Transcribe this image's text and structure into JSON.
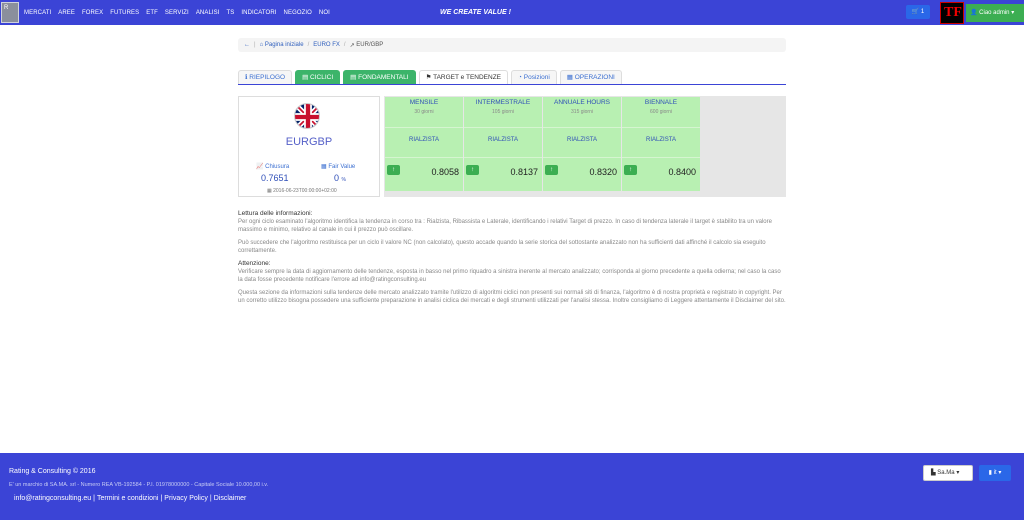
{
  "nav": {
    "items": [
      "MERCATI",
      "AREE",
      "FOREX",
      "FUTURES",
      "ETF",
      "SERVIZI",
      "ANALISI",
      "TS",
      "INDICATORI",
      "NEGOZIO",
      "NOI"
    ],
    "tagline": "WE CREATE VALUE !",
    "cart_count": "1",
    "user_label": "Ciao admin"
  },
  "breadcrumb": {
    "home": "Pagina iniziale",
    "section": "EURO FX",
    "current": "EUR/GBP"
  },
  "tabs": [
    {
      "label": "RIEPILOGO",
      "icon": "info-icon",
      "style": "plain"
    },
    {
      "label": "CICLICI",
      "icon": "chart-icon",
      "style": "green"
    },
    {
      "label": "FONDAMENTALI",
      "icon": "chart-icon",
      "style": "green"
    },
    {
      "label": "TARGET e TENDENZE",
      "icon": "flag-icon",
      "style": "active"
    },
    {
      "label": "Posizioni",
      "icon": "pie-icon",
      "style": "plain"
    },
    {
      "label": "OPERAZIONI",
      "icon": "calendar-icon",
      "style": "plain"
    }
  ],
  "instrument": {
    "name": "EURGBP",
    "close_label": "Chiusura",
    "close_value": "0.7651",
    "fair_label": "Fair Value",
    "fair_value": "0",
    "fair_unit": "%",
    "date": "2016-06-23T00:00:00+02:00"
  },
  "cycles": [
    {
      "name": "MENSILE",
      "period": "30 giorni",
      "trend": "RIALZISTA",
      "target": "0.8058"
    },
    {
      "name": "INTERMESTRALE",
      "period": "105 giorni",
      "trend": "RIALZISTA",
      "target": "0.8137"
    },
    {
      "name": "ANNUALE HOURS",
      "period": "315 giorni",
      "trend": "RIALZISTA",
      "target": "0.8320"
    },
    {
      "name": "BIENNALE",
      "period": "600 giorni",
      "trend": "RIALZISTA",
      "target": "0.8400"
    }
  ],
  "info": {
    "title1": "Lettura delle informazioni:",
    "p1": "Per ogni ciclo esaminato l'algoritmo identifica la tendenza in corso tra : Rialzista, Ribassista e Laterale, identificando i relativi Target di prezzo. In caso di tendenza laterale il target è stabilito tra un valore massimo e minimo, relativo al canale in cui il prezzo può oscillare.",
    "p2": "Può succedere che l'algoritmo restituisca per un ciclo il valore NC (non calcolato), questo accade quando la serie storica del sottostante analizzato non ha sufficienti dati affinché il calcolo sia eseguito correttamente.",
    "title2": "Attenzione:",
    "p3": "Verificare sempre la data di aggiornamento delle tendenze, esposta in basso nel primo riquadro a sinistra inerente al mercato analizzato; corrisponda al giorno precedente a quella odierna; nel caso la caso la data fosse precedente notificare l'errore ad info@ratingconsulting.eu",
    "p4": "Questa sezione da informazioni sulla tendenze delle mercato analizzato tramite l'utilizzo di algoritmi ciclici non presenti sui normali siti di finanza, l'algoritmo è di nostra proprietà e registrato in copyright. Per un corretto utilizzo bisogna possedere una sufficiente preparazione in analisi ciclica dei mercati e degli strumenti utilizzati per l'analisi stessa. Inoltre consigliamo di Leggere attentamente il Disclaimer del sito."
  },
  "footer": {
    "copyright": "Rating & Consulting © 2016",
    "legal": "E' un marchio di SA.MA. srl - Numero REA VB-192584 - P.I. 01978000000 - Capitale Sociale 10.000,00 i.v.",
    "links": [
      "info@ratingconsulting.eu",
      "Termini e condizioni",
      "Privacy Policy",
      "Disclaimer"
    ],
    "sama_btn": "Sa.Ma",
    "lang_btn": "it"
  }
}
